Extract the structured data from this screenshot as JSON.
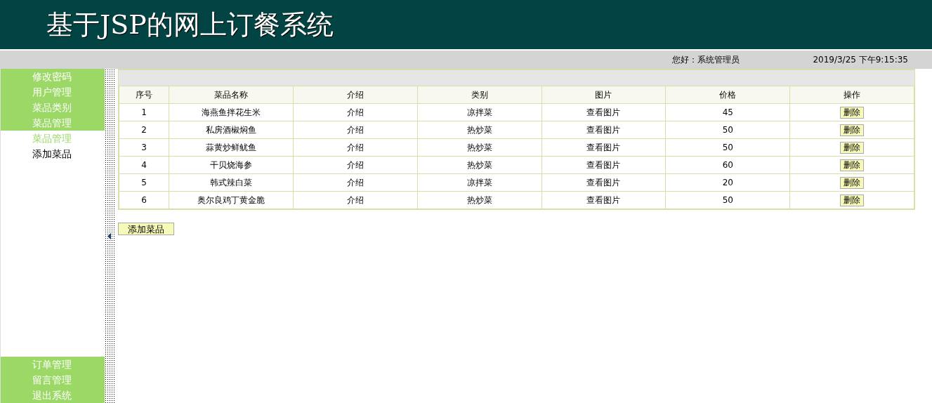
{
  "header": {
    "title": "基于JSP的网上订餐系统"
  },
  "status_bar": {
    "greeting": "您好：系统管理员",
    "datetime": "2019/3/25 下午9:15:35"
  },
  "sidebar": {
    "top_items": [
      {
        "label": "修改密码",
        "kind": "group"
      },
      {
        "label": "用户管理",
        "kind": "group"
      },
      {
        "label": "菜品类别",
        "kind": "group"
      },
      {
        "label": "菜品管理",
        "kind": "group"
      },
      {
        "label": "菜品管理",
        "kind": "link",
        "selected": true
      },
      {
        "label": "添加菜品",
        "kind": "link",
        "selected": false
      }
    ],
    "bottom_items": [
      "订单管理",
      "留言管理",
      "退出系统"
    ]
  },
  "table": {
    "columns": [
      "序号",
      "菜品名称",
      "介绍",
      "类别",
      "图片",
      "价格",
      "操作"
    ],
    "rows": [
      [
        "1",
        "海燕鱼拌花生米",
        "介绍",
        "凉拌菜",
        "查看图片",
        "45",
        "删除"
      ],
      [
        "2",
        "私房酒椒焖鱼",
        "介绍",
        "热炒菜",
        "查看图片",
        "50",
        "删除"
      ],
      [
        "3",
        "蒜黄炒鲜鱿鱼",
        "介绍",
        "热炒菜",
        "查看图片",
        "50",
        "删除"
      ],
      [
        "4",
        "干贝烧海参",
        "介绍",
        "热炒菜",
        "查看图片",
        "60",
        "删除"
      ],
      [
        "5",
        "韩式辣白菜",
        "介绍",
        "凉拌菜",
        "查看图片",
        "20",
        "删除"
      ],
      [
        "6",
        "奥尔良鸡丁黄金脆",
        "介绍",
        "热炒菜",
        "查看图片",
        "50",
        "删除"
      ]
    ]
  },
  "add_button": "添加菜品"
}
